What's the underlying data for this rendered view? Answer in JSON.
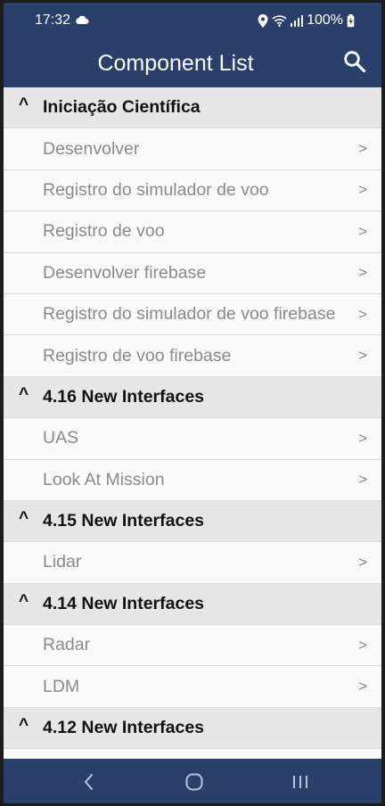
{
  "status_bar": {
    "time": "17:32",
    "battery": "100%",
    "icons": [
      "cloud-icon",
      "location-icon",
      "wifi-icon",
      "signal-icon",
      "battery-charging-icon"
    ]
  },
  "app_bar": {
    "title": "Component List",
    "search_icon": "search-icon"
  },
  "sections": [
    {
      "caret": "^",
      "title": "Iniciação Científica",
      "items": [
        {
          "label": "Desenvolver",
          "chevron": ">"
        },
        {
          "label": "Registro do simulador de voo",
          "chevron": ">"
        },
        {
          "label": "Registro de voo",
          "chevron": ">"
        },
        {
          "label": "Desenvolver firebase",
          "chevron": ">"
        },
        {
          "label": "Registro do simulador de voo firebase",
          "chevron": ">"
        },
        {
          "label": "Registro de voo firebase",
          "chevron": ">"
        }
      ]
    },
    {
      "caret": "^",
      "title": "4.16 New Interfaces",
      "items": [
        {
          "label": "UAS",
          "chevron": ">"
        },
        {
          "label": "Look At Mission",
          "chevron": ">"
        }
      ]
    },
    {
      "caret": "^",
      "title": "4.15 New Interfaces",
      "items": [
        {
          "label": "Lidar",
          "chevron": ">"
        }
      ]
    },
    {
      "caret": "^",
      "title": "4.14 New Interfaces",
      "items": [
        {
          "label": "Radar",
          "chevron": ">"
        },
        {
          "label": "LDM",
          "chevron": ">"
        }
      ]
    },
    {
      "caret": "^",
      "title": "4.12 New Interfaces",
      "items": []
    }
  ],
  "nav_bar": {
    "icons": [
      "back-icon",
      "home-icon",
      "recents-icon"
    ]
  },
  "colors": {
    "primary": "#2b3f6b",
    "section_bg": "#e6e6e6",
    "list_bg": "#fafafa",
    "item_text": "#8a8a8a"
  }
}
